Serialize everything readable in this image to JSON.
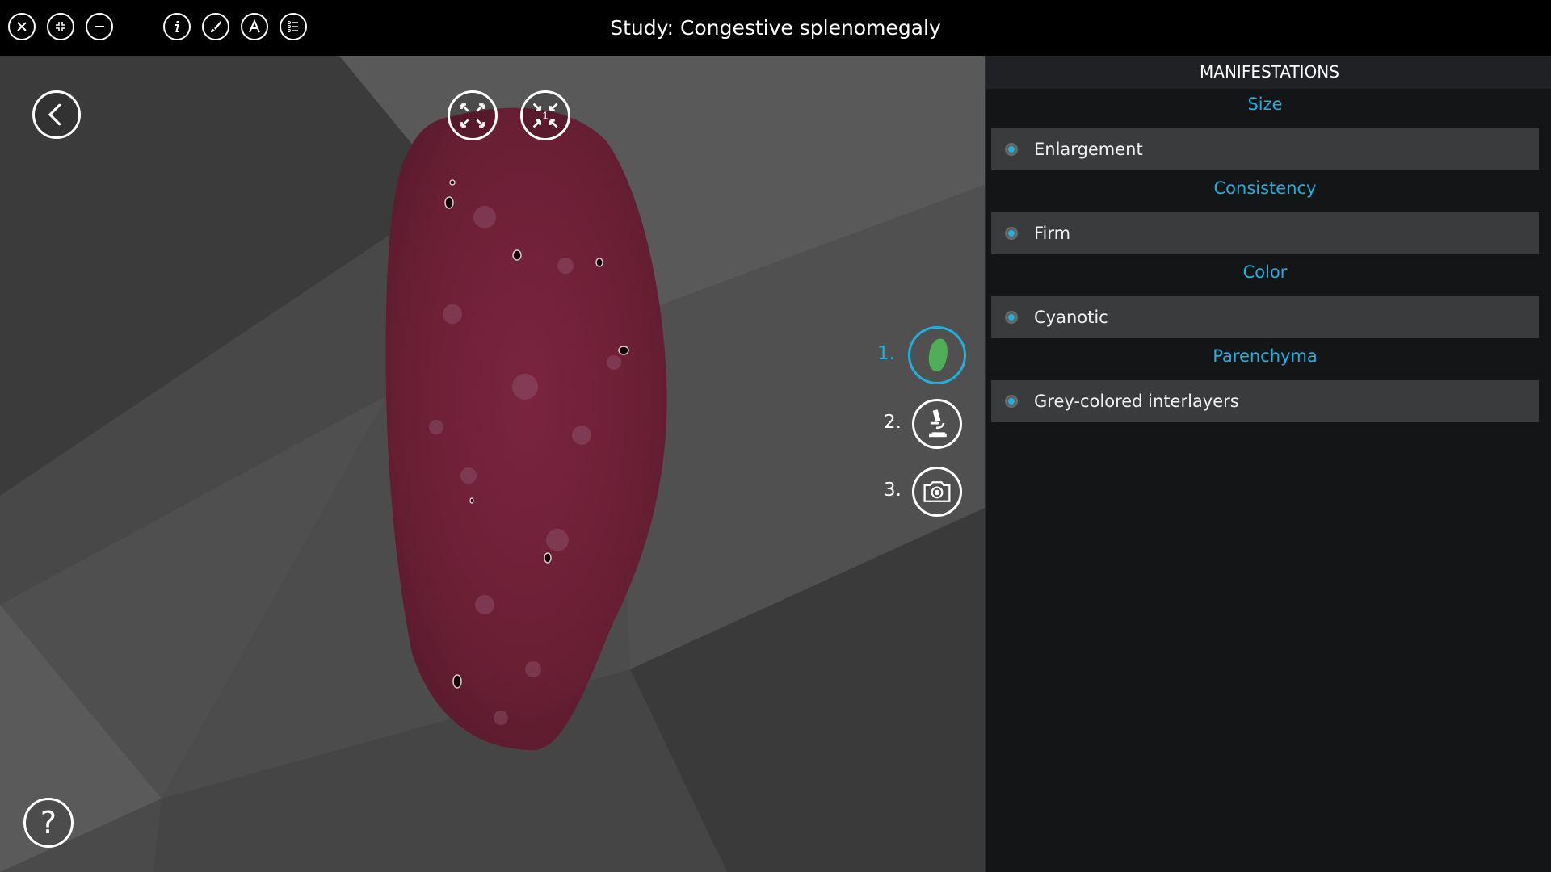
{
  "window": {
    "title": "Study: Congestive splenomegaly"
  },
  "toolbar": {
    "icons": [
      "close-icon",
      "fullscreen-exit-icon",
      "minimize-icon",
      "info-icon",
      "brush-icon",
      "text-font-icon",
      "list-icon"
    ]
  },
  "viewer": {
    "back_icon": "chevron-left-icon",
    "help_label": "?",
    "fit_icon": "expand-arrows-icon",
    "fit_one_icon": "compress-arrows-icon",
    "fit_one_label": "1",
    "steps": [
      {
        "number": "1.",
        "icon": "specimen-icon",
        "active": true
      },
      {
        "number": "2.",
        "icon": "microscope-icon",
        "active": false
      },
      {
        "number": "3.",
        "icon": "camera-icon",
        "active": false
      }
    ]
  },
  "panel": {
    "header": "MANIFESTATIONS",
    "groups": [
      {
        "category": "Size",
        "items": [
          "Enlargement"
        ]
      },
      {
        "category": "Consistency",
        "items": [
          "Firm"
        ]
      },
      {
        "category": "Color",
        "items": [
          "Cyanotic"
        ]
      },
      {
        "category": "Parenchyma",
        "items": [
          "Grey-colored interlayers"
        ]
      }
    ]
  },
  "colors": {
    "accent": "#1fb0e0",
    "specimen": "#6e2136",
    "panel_bg": "#141517",
    "item_bg": "#3a3b3d"
  }
}
